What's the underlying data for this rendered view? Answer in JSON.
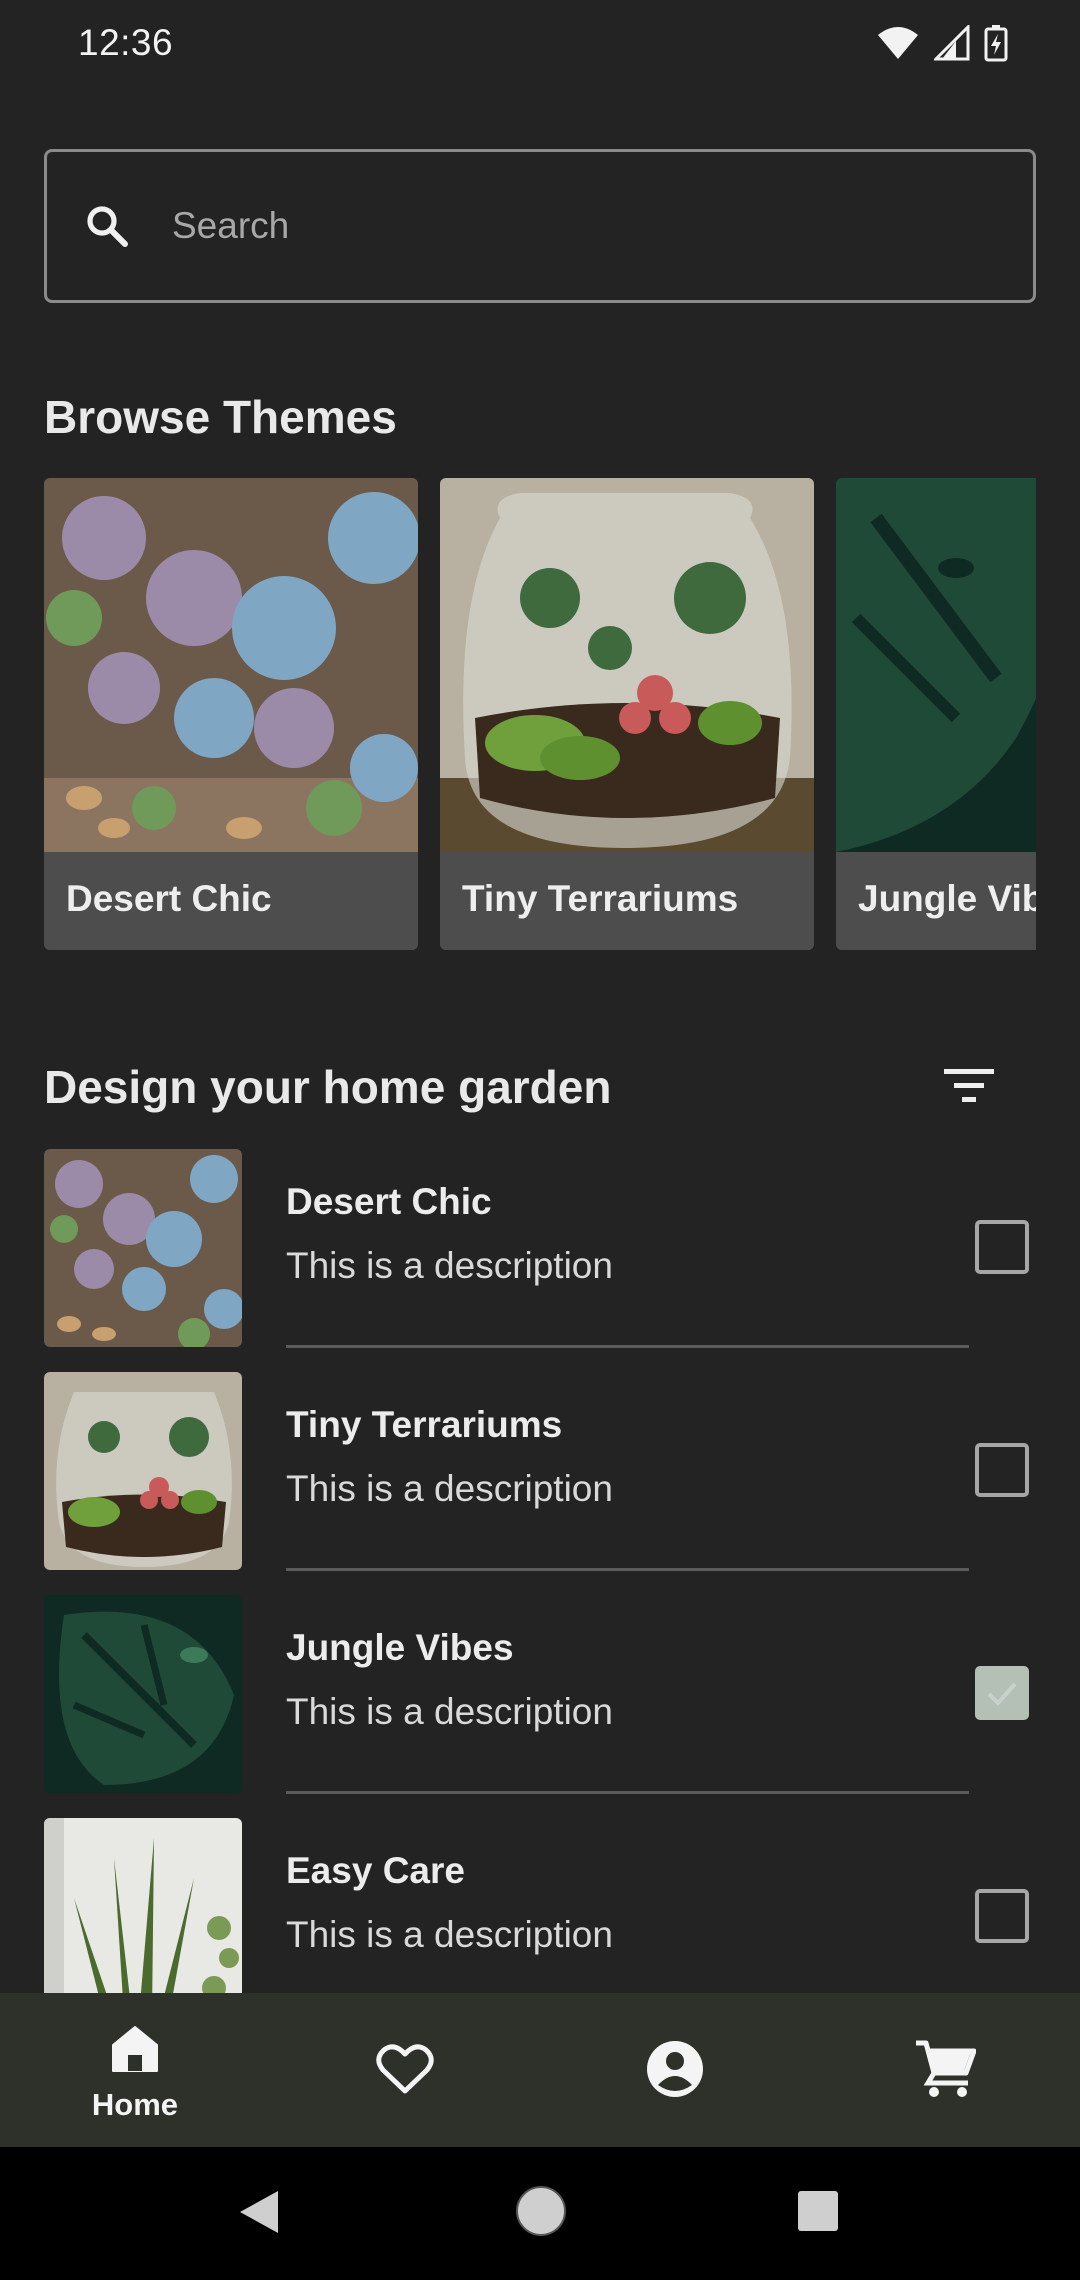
{
  "status_bar": {
    "time": "12:36",
    "icons": [
      "wifi-icon",
      "signal-icon",
      "battery-charging-icon"
    ]
  },
  "search": {
    "placeholder": "Search",
    "icon": "search-icon"
  },
  "browse": {
    "title": "Browse Themes",
    "themes": [
      {
        "label": "Desert Chic"
      },
      {
        "label": "Tiny Terrariums"
      },
      {
        "label": "Jungle Vibes"
      }
    ]
  },
  "design": {
    "title": "Design your home garden",
    "filter_icon": "filter-icon",
    "items": [
      {
        "title": "Desert Chic",
        "description": "This is a description",
        "checked": false
      },
      {
        "title": "Tiny Terrariums",
        "description": "This is a description",
        "checked": false
      },
      {
        "title": "Jungle Vibes",
        "description": "This is a description",
        "checked": true
      },
      {
        "title": "Easy Care",
        "description": "This is a description",
        "checked": false
      }
    ]
  },
  "bottom_nav": {
    "items": [
      {
        "icon": "home-icon",
        "label": "Home",
        "active": true
      },
      {
        "icon": "heart-icon",
        "label": "",
        "active": false
      },
      {
        "icon": "account-icon",
        "label": "",
        "active": false
      },
      {
        "icon": "cart-icon",
        "label": "",
        "active": false
      }
    ]
  },
  "colors": {
    "background": "#232323",
    "nav_background": "#2d312a",
    "checkbox_checked": "#b4c0b6"
  }
}
